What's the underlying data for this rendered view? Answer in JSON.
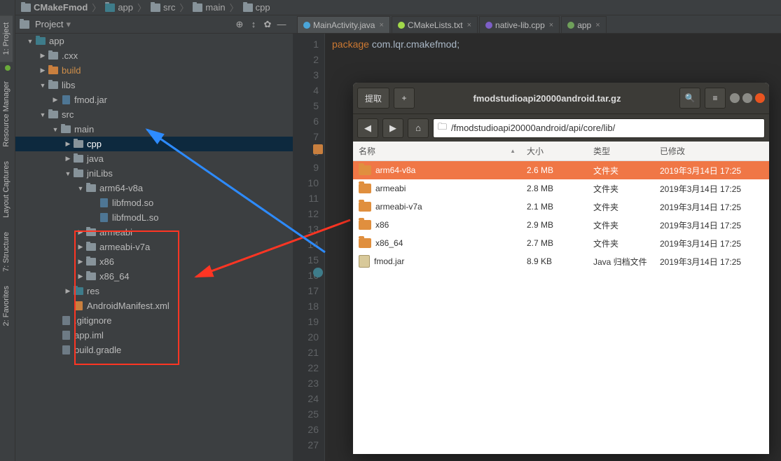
{
  "breadcrumb": [
    "CMakeFmod",
    "app",
    "src",
    "main",
    "cpp"
  ],
  "projectPanel": {
    "title": "Project"
  },
  "sidebar": {
    "tabs": [
      "2: Favorites",
      "7: Structure",
      "Layout Captures",
      "Resource Manager",
      "1: Project"
    ]
  },
  "tree": [
    {
      "d": 0,
      "exp": true,
      "ico": "fld-teal",
      "label": "app"
    },
    {
      "d": 1,
      "exp": false,
      "ico": "fld",
      "label": ".cxx"
    },
    {
      "d": 1,
      "exp": false,
      "ico": "fld-orange",
      "label": "build",
      "hl": true
    },
    {
      "d": 1,
      "exp": true,
      "ico": "fld",
      "label": "libs"
    },
    {
      "d": 2,
      "exp": false,
      "ico": "jar",
      "label": "fmod.jar"
    },
    {
      "d": 1,
      "exp": true,
      "ico": "fld",
      "label": "src"
    },
    {
      "d": 2,
      "exp": true,
      "ico": "fld",
      "label": "main"
    },
    {
      "d": 3,
      "exp": false,
      "ico": "fld",
      "label": "cpp",
      "sel": true
    },
    {
      "d": 3,
      "exp": false,
      "ico": "fld",
      "label": "java"
    },
    {
      "d": 3,
      "exp": true,
      "ico": "fld",
      "label": "jniLibs"
    },
    {
      "d": 4,
      "exp": true,
      "ico": "fld",
      "label": "arm64-v8a"
    },
    {
      "d": 5,
      "exp": null,
      "ico": "so",
      "label": "libfmod.so"
    },
    {
      "d": 5,
      "exp": null,
      "ico": "so",
      "label": "libfmodL.so"
    },
    {
      "d": 4,
      "exp": false,
      "ico": "fld",
      "label": "armeabi"
    },
    {
      "d": 4,
      "exp": false,
      "ico": "fld",
      "label": "armeabi-v7a"
    },
    {
      "d": 4,
      "exp": false,
      "ico": "fld",
      "label": "x86"
    },
    {
      "d": 4,
      "exp": false,
      "ico": "fld",
      "label": "x86_64"
    },
    {
      "d": 3,
      "exp": false,
      "ico": "fld-teal",
      "label": "res"
    },
    {
      "d": 3,
      "exp": null,
      "ico": "xml",
      "label": "AndroidManifest.xml"
    },
    {
      "d": 2,
      "exp": null,
      "ico": "file",
      "label": ".gitignore"
    },
    {
      "d": 2,
      "exp": null,
      "ico": "file",
      "label": "app.iml"
    },
    {
      "d": 2,
      "exp": null,
      "ico": "file",
      "label": "build.gradle"
    }
  ],
  "editorTabs": [
    {
      "label": "MainActivity.java",
      "color": "#4aa5d9",
      "active": true
    },
    {
      "label": "CMakeLists.txt",
      "color": "#a2d94a"
    },
    {
      "label": "native-lib.cpp",
      "color": "#7d5fc7"
    },
    {
      "label": "app",
      "color": "#6fa05a"
    }
  ],
  "editor": {
    "lines": 27,
    "code": {
      "kw": "package",
      "pkg": "com.lqr.cmakefmod",
      "semi": ";"
    }
  },
  "fm": {
    "extractLabel": "提取",
    "title": "fmodstudioapi20000android.tar.gz",
    "path": "/fmodstudioapi20000android/api/core/lib/",
    "cols": {
      "name": "名称",
      "size": "大小",
      "type": "类型",
      "mod": "已修改"
    },
    "rows": [
      {
        "name": "arm64-v8a",
        "size": "2.6 MB",
        "type": "文件夹",
        "mod": "2019年3月14日 17:25",
        "ico": "folder",
        "sel": true
      },
      {
        "name": "armeabi",
        "size": "2.8 MB",
        "type": "文件夹",
        "mod": "2019年3月14日 17:25",
        "ico": "folder"
      },
      {
        "name": "armeabi-v7a",
        "size": "2.1 MB",
        "type": "文件夹",
        "mod": "2019年3月14日 17:25",
        "ico": "folder"
      },
      {
        "name": "x86",
        "size": "2.9 MB",
        "type": "文件夹",
        "mod": "2019年3月14日 17:25",
        "ico": "folder"
      },
      {
        "name": "x86_64",
        "size": "2.7 MB",
        "type": "文件夹",
        "mod": "2019年3月14日 17:25",
        "ico": "folder"
      },
      {
        "name": "fmod.jar",
        "size": "8.9 KB",
        "type": "Java 归档文件",
        "mod": "2019年3月14日 17:25",
        "ico": "jar"
      }
    ]
  }
}
